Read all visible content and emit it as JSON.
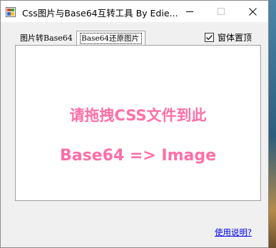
{
  "window": {
    "title": "Css图片与Base64互转工具 By Edie...",
    "icon": "app-icon"
  },
  "tabs": [
    {
      "label": "图片转Base64",
      "active": false
    },
    {
      "label": "Base64还原图片",
      "active": true
    }
  ],
  "options": {
    "topmost_label": "窗体置顶",
    "topmost_checked": true
  },
  "drop_area": {
    "line1": "请拖拽CSS文件到此",
    "line2": "Base64 => Image",
    "text_color": "#ff6fa8"
  },
  "help_link": "使用说明?"
}
